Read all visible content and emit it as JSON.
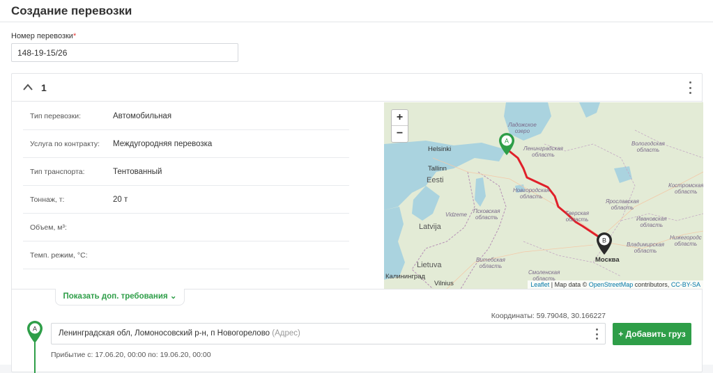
{
  "page": {
    "title": "Создание перевозки"
  },
  "shipment_number": {
    "label": "Номер перевозки",
    "required_mark": "*",
    "value": "148-19-15/26"
  },
  "card": {
    "number": "1",
    "properties": [
      {
        "key": "Тип перевозки:",
        "value": "Автомобильная"
      },
      {
        "key": "Услуга по контракту:",
        "value": "Междугородняя перевозка"
      },
      {
        "key": "Тип транспорта:",
        "value": "Тентованный"
      },
      {
        "key": "Тоннаж, т:",
        "value": "20 т"
      },
      {
        "key": "Объем, м³:",
        "value": ""
      },
      {
        "key": "Темп. режим, °С:",
        "value": ""
      }
    ],
    "show_more_label": "Показать доп. требования",
    "show_more_chevron": "⌄"
  },
  "map": {
    "zoom_in": "+",
    "zoom_out": "−",
    "attribution": {
      "leaflet": "Leaflet",
      "sep1": " | Map data © ",
      "osm": "OpenStreetMap",
      "contrib": " contributors, ",
      "license": "CC-BY-SA"
    },
    "labels": {
      "helsinki": "Helsinki",
      "tallinn": "Tallinn",
      "eesti": "Eesti",
      "latvija": "Latvija",
      "lietuva": "Lietuva",
      "vilnius": "Vilnius",
      "kaliningrad": "Калининград",
      "moskva": "Москва",
      "vidzeme": "Vidzeme",
      "ladoga": "Ладожское\nозеро",
      "lenobl": "Ленинградская\nобласть",
      "novgorod": "Новгородская\nобласть",
      "pskov": "Псковская\nобласть",
      "tver": "Тверская\nобласть",
      "vologda": "Вологодская\nобласть",
      "yaroslavl": "Ярославская\nобласть",
      "kostroma": "Костромская\nобласть",
      "ivanovo": "Ивановская\nобласть",
      "vladimir": "Владимирская\nобласть",
      "nizhny": "Нижегородс\nобласть",
      "vitebsk": "Витебская\nобласть",
      "smolensk": "Смоленская\nобласть"
    },
    "marker_a": "A",
    "marker_b": "B",
    "route_color": "#e0202a"
  },
  "route_point": {
    "marker": "A",
    "coordinates_text": "Координаты: 59.79048, 30.166227",
    "address": "Ленинградская обл, Ломоносовский р-н, п Новогорелово",
    "address_placeholder": "(Адрес)",
    "add_cargo_label": "+ Добавить груз",
    "arrival_text": "Прибытие с: 17.06.20, 00:00 по: 19.06.20, 00:00"
  },
  "colors": {
    "accent": "#2e9e48",
    "required": "#e53935"
  }
}
